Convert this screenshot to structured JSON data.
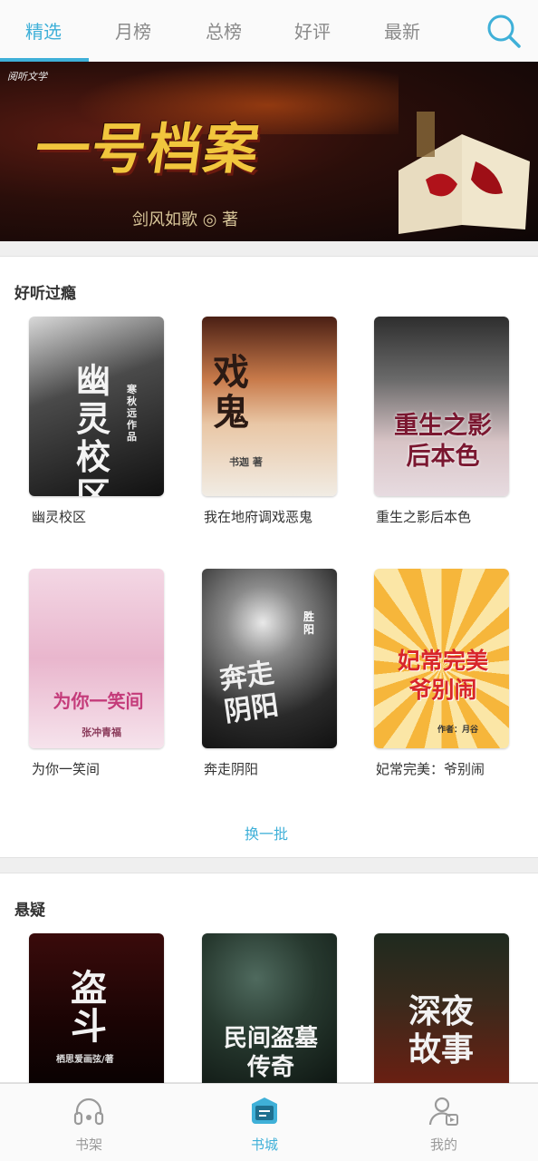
{
  "tabs": [
    {
      "label": "精选",
      "active": true
    },
    {
      "label": "月榜",
      "active": false
    },
    {
      "label": "总榜",
      "active": false
    },
    {
      "label": "好评",
      "active": false
    },
    {
      "label": "最新",
      "active": false
    }
  ],
  "search_icon": "search-icon",
  "banner": {
    "logo": "阅听文学",
    "title": "一号档案",
    "author": "剑风如歌 ◎ 著",
    "dots_count": 6,
    "active_dot": 0
  },
  "section1": {
    "title": "好听过瘾",
    "books": [
      {
        "name": "幽灵校区",
        "cover_text": "幽灵校区",
        "cover_sub": "寒秋远作品"
      },
      {
        "name": "我在地府调戏恶鬼",
        "cover_text": "戏鬼",
        "cover_sub": "书迦 著"
      },
      {
        "name": "重生之影后本色",
        "cover_text": "重生之影后本色",
        "cover_sub": ""
      },
      {
        "name": "为你一笑间",
        "cover_text": "为你一笑间",
        "cover_sub": "张冲青福"
      },
      {
        "name": "奔走阴阳",
        "cover_text": "奔走阴阳",
        "cover_sub": "胜阳"
      },
      {
        "name": "妃常完美：爷别闹",
        "cover_text": "妃常完美 爷别闹",
        "cover_sub": "作者：月谷"
      }
    ],
    "refresh": "换一批"
  },
  "section2": {
    "title": "悬疑",
    "books": [
      {
        "cover_text": "盗斗",
        "cover_sub": "栖思爱画弦/著"
      },
      {
        "cover_text": "民间盗墓传奇",
        "cover_sub": ""
      },
      {
        "cover_text": "深夜故事",
        "cover_sub": ""
      }
    ]
  },
  "bottom_nav": [
    {
      "label": "书架",
      "icon": "headphones-icon",
      "active": false
    },
    {
      "label": "书城",
      "icon": "bookstore-icon",
      "active": true
    },
    {
      "label": "我的",
      "icon": "user-icon",
      "active": false
    }
  ],
  "colors": {
    "accent": "#3fb0d8",
    "tab_inactive": "#8a8a8a",
    "banner_title": "#f1c63d"
  }
}
